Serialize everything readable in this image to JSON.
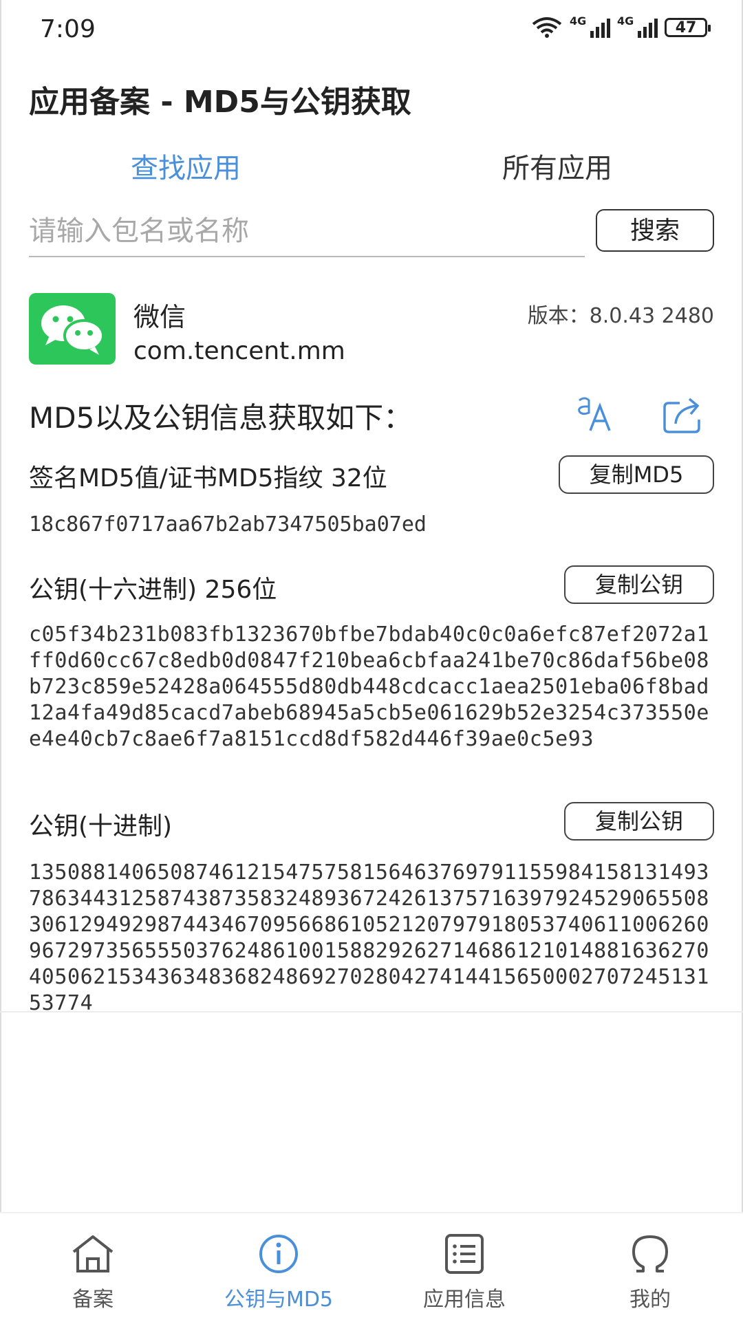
{
  "status": {
    "time": "7:09",
    "net1": "4G",
    "net2": "4G",
    "battery": "47"
  },
  "app_title": "应用备案 - MD5与公钥获取",
  "tabs": {
    "find": "查找应用",
    "all": "所有应用"
  },
  "search": {
    "placeholder": "请输入包名或名称",
    "button": "搜索"
  },
  "app": {
    "name": "微信",
    "package": "com.tencent.mm",
    "version": "版本：8.0.43   2480"
  },
  "section_heading": "MD5以及公钥信息获取如下：",
  "md5": {
    "label": "签名MD5值/证书MD5指纹   32位",
    "copy": "复制MD5",
    "value": "18c867f0717aa67b2ab7347505ba07ed"
  },
  "pubkey_hex": {
    "label": "公钥(十六进制)   256位",
    "copy": "复制公钥",
    "value": "c05f34b231b083fb1323670bfbe7bdab40c0c0a6efc87ef2072a1ff0d60cc67c8edb0d0847f210bea6cbfaa241be70c86daf56be08b723c859e52428a064555d80db448cdcacc1aea2501eba06f8bad12a4fa49d85cacd7abeb68945a5cb5e061629b52e3254c373550ee4e40cb7c8ae6f7a8151ccd8df582d446f39ae0c5e93"
  },
  "pubkey_dec": {
    "label": "公钥(十进制)",
    "copy": "复制公钥",
    "value": "135088140650874612154757581564637697911559841581314937863443125874387358324893672426137571639792452906550830612949298744346709566861052120797918053740611006260967297356555037624861001588292627146861210148816362704050621534363483682486927028042741441565000270724513153774"
  },
  "nav": [
    {
      "label": "备案",
      "icon": "home-icon"
    },
    {
      "label": "公钥与MD5",
      "icon": "info-icon"
    },
    {
      "label": "应用信息",
      "icon": "list-icon"
    },
    {
      "label": "我的",
      "icon": "user-icon"
    }
  ],
  "colors": {
    "accent": "#4a8fd9",
    "wechat_green": "#2dc65a"
  }
}
